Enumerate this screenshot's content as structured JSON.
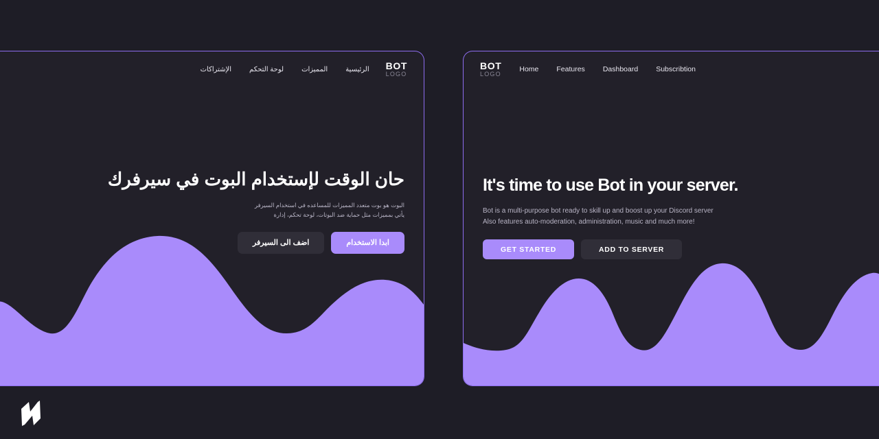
{
  "theme": {
    "page_bg": "#1e1d26",
    "card_bg": "#222029",
    "accent": "#a98bfb",
    "border": "#8e6df0",
    "text": "#ffffff",
    "muted": "#b9b5c6",
    "secondary_btn": "#302e38"
  },
  "arabic_card": {
    "brand": {
      "top": "BOT",
      "sub": "LOGO"
    },
    "nav": [
      {
        "label": "الرئيسية"
      },
      {
        "label": "المميزات"
      },
      {
        "label": "لوحة التحكم"
      },
      {
        "label": "الإشتراكات"
      }
    ],
    "title": "حان الوقت لإستخدام البوت في سيرفرك",
    "subtitle_lines": [
      "البوت هو بوت متعدد المميزات للمساعده في استخدام السيرفر",
      "يأتي بمميزات مثل حماية ضد البوتات، لوحة تحكم، إدارة"
    ],
    "buttons": {
      "primary": "ابدا الاستخدام",
      "secondary": "اضف الى السيرفر"
    }
  },
  "english_card": {
    "brand": {
      "top": "BOT",
      "sub": "LOGO"
    },
    "nav": [
      {
        "label": "Home"
      },
      {
        "label": "Features"
      },
      {
        "label": "Dashboard"
      },
      {
        "label": "Subscribtion"
      }
    ],
    "title": "It's time to use Bot in your server.",
    "subtitle_lines": [
      "Bot is a multi-purpose bot ready to skill up and boost up your Discord server",
      "Also features auto-moderation, administration, music and much more!"
    ],
    "buttons": {
      "primary": "GET STARTED",
      "secondary": "ADD TO SERVER"
    }
  },
  "corner_mark": {
    "name": "z-logo-mark",
    "color": "#ffffff"
  }
}
